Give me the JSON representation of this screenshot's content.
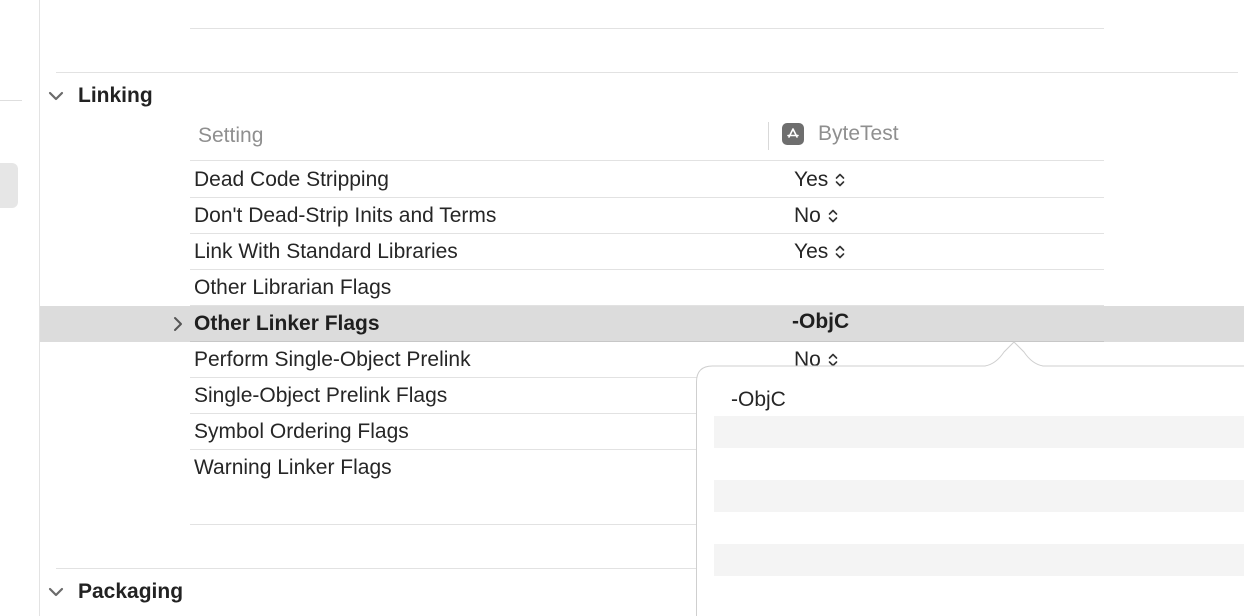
{
  "sections": {
    "linking": {
      "title": "Linking"
    },
    "packaging": {
      "title": "Packaging"
    }
  },
  "table": {
    "setting_header": "Setting",
    "target_header": "ByteTest",
    "rows": [
      {
        "name": "Dead Code Stripping",
        "value": "Yes",
        "stepper": true
      },
      {
        "name": "Don't Dead-Strip Inits and Terms",
        "value": "No",
        "stepper": true
      },
      {
        "name": "Link With Standard Libraries",
        "value": "Yes",
        "stepper": true
      },
      {
        "name": "Other Librarian Flags",
        "value": "",
        "stepper": false
      },
      {
        "name": "Other Linker Flags",
        "value": "-ObjC",
        "stepper": false,
        "selected": true
      },
      {
        "name": "Perform Single-Object Prelink",
        "value": "No",
        "stepper": true
      },
      {
        "name": "Single-Object Prelink Flags",
        "value": "",
        "stepper": false
      },
      {
        "name": "Symbol Ordering Flags",
        "value": "",
        "stepper": false
      },
      {
        "name": "Warning Linker Flags",
        "value": "",
        "stepper": false
      }
    ]
  },
  "popover": {
    "items": [
      "-ObjC",
      "",
      "",
      "",
      "",
      "",
      ""
    ]
  },
  "colors": {
    "selected_row": "#dcdcdc",
    "separator": "#e2e2e2",
    "header_text": "#8f8f8f",
    "alt_row": "#f4f4f4"
  }
}
